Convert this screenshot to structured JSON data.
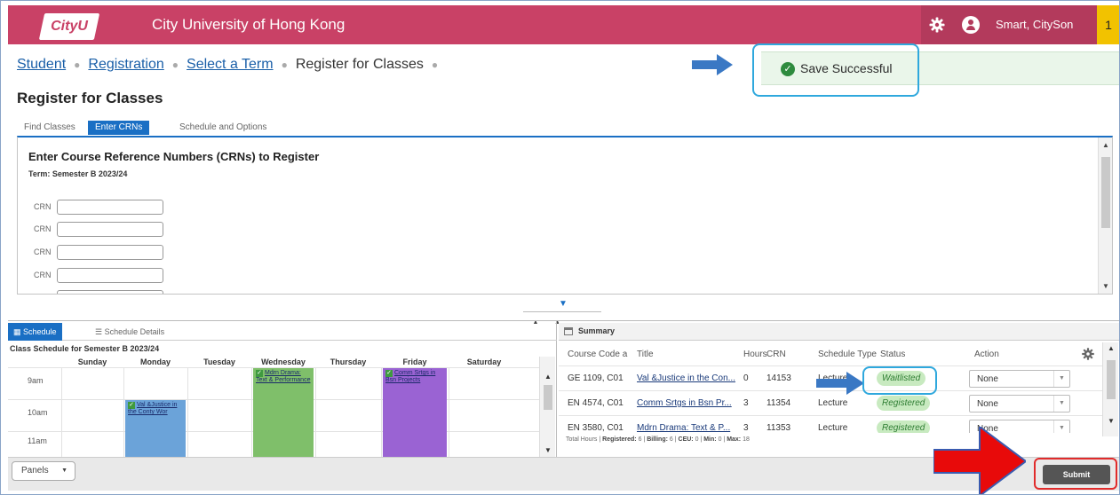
{
  "header": {
    "logo_text": "CityU",
    "university_name": "City University of Hong Kong",
    "user_name": "Smart, CitySon",
    "notification_count": "1"
  },
  "breadcrumb": {
    "items": [
      "Student",
      "Registration",
      "Select a Term",
      "Register for Classes"
    ]
  },
  "alert": {
    "message": "Save Successful"
  },
  "page_title": "Register for Classes",
  "tabs": [
    "Find Classes",
    "Enter CRNs",
    "Schedule and Options"
  ],
  "crn_panel": {
    "title": "Enter Course Reference Numbers (CRNs) to Register",
    "term": "Term: Semester B 2023/24",
    "field_label": "CRN",
    "fields": [
      "",
      "",
      "",
      ""
    ]
  },
  "schedule": {
    "tabs": [
      "Schedule",
      "Schedule Details"
    ],
    "title": "Class Schedule for Semester B 2023/24",
    "days": [
      "Sunday",
      "Monday",
      "Tuesday",
      "Wednesday",
      "Thursday",
      "Friday",
      "Saturday"
    ],
    "times": [
      "9am",
      "10am",
      "11am"
    ],
    "events": [
      {
        "day": "Wednesday",
        "label": "Mdrn Drama: Text & Performance",
        "color": "#7fbf6a"
      },
      {
        "day": "Friday",
        "label": "Comm Srtgs in Bsn Projects",
        "color": "#9a63d3"
      },
      {
        "day": "Monday",
        "label": "Val &Justice in the Conty Wor",
        "color": "#6ba3d9"
      }
    ]
  },
  "summary": {
    "title": "Summary",
    "columns": [
      "Course Code a",
      "Title",
      "Hours",
      "CRN",
      "Schedule Type",
      "Status",
      "Action"
    ],
    "rows": [
      {
        "code": "GE 1109, C01",
        "title": "Val &Justice in the Con...",
        "hours": "0",
        "crn": "14153",
        "type": "Lecture",
        "status": "Waitlisted",
        "action": "None"
      },
      {
        "code": "EN 4574, C01",
        "title": "Comm Srtgs in Bsn Pr...",
        "hours": "3",
        "crn": "11354",
        "type": "Lecture",
        "status": "Registered",
        "action": "None"
      },
      {
        "code": "EN 3580, C01",
        "title": "Mdrn Drama: Text & P...",
        "hours": "3",
        "crn": "11353",
        "type": "Lecture",
        "status": "Registered",
        "action": "None"
      }
    ],
    "totals": {
      "label": "Total Hours",
      "registered_label": "Registered:",
      "registered": "6",
      "billing_label": "Billing:",
      "billing": "6",
      "ceu_label": "CEU:",
      "ceu": "0",
      "min_label": "Min:",
      "min": "0",
      "max_label": "Max:",
      "max": "18"
    }
  },
  "footer": {
    "panels_label": "Panels",
    "submit_label": "Submit"
  },
  "colors": {
    "header_bg": "#c94166",
    "accent_blue": "#1a6fc4",
    "success_green": "#2e8b3e",
    "highlight_red": "#e12b2b",
    "highlight_blue": "#2fa8dd"
  }
}
